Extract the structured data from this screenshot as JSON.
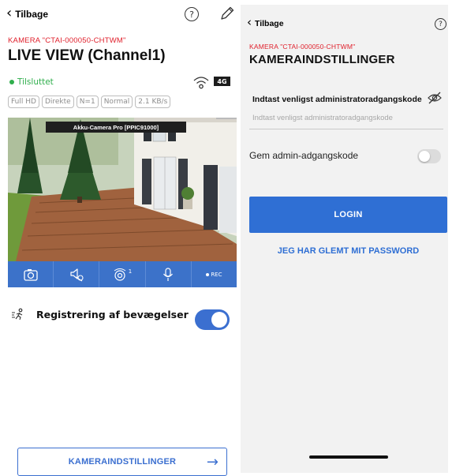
{
  "left_screen": {
    "back_label": "Tilbage",
    "help_glyph": "?",
    "edit_icon": "pencil-icon",
    "camera_id": "KAMERA \"CTAI-000050-CHTWM\"",
    "title": "LIVE VIEW  (Channel1)",
    "status": {
      "label": "Tilsluttet",
      "color": "#2fae4c"
    },
    "signal_icon": "wifi-icon",
    "network_badge": "4G",
    "chips": [
      "Full HD",
      "Direkte",
      "N=1",
      "Normal",
      "2.1 KB/s"
    ],
    "video_caption": "Akku-Camera Pro [PPIC91000]",
    "controls": [
      {
        "icon": "snapshot-icon"
      },
      {
        "icon": "speaker-mute-icon"
      },
      {
        "icon": "siren-icon",
        "badge": "1"
      },
      {
        "icon": "microphone-icon"
      },
      {
        "icon": "record-icon",
        "label": "REC"
      }
    ],
    "motion": {
      "label": "Registrering af bevægelser",
      "icon": "motion-icon",
      "enabled": true
    },
    "settings_button": "KAMERAINDSTILLINGER",
    "accent": "#3b6fd0"
  },
  "right_screen": {
    "back_label": "Tilbage",
    "help_glyph": "?",
    "camera_id": "KAMERA \"CTAI-000050-CHTWM\"",
    "title": "KAMERAINDSTILLINGER",
    "password_label": "Indtast venligst administratoradgangskode",
    "password_placeholder": "Indtast venligst administratoradgangskode",
    "visibility_icon": "eye-off-icon",
    "save_password_label": "Gem admin-adgangskode",
    "save_password_enabled": false,
    "login_button": "LOGIN",
    "forgot_link": "JEG HAR GLEMT MIT PASSWORD",
    "accent": "#2f6fd4"
  }
}
